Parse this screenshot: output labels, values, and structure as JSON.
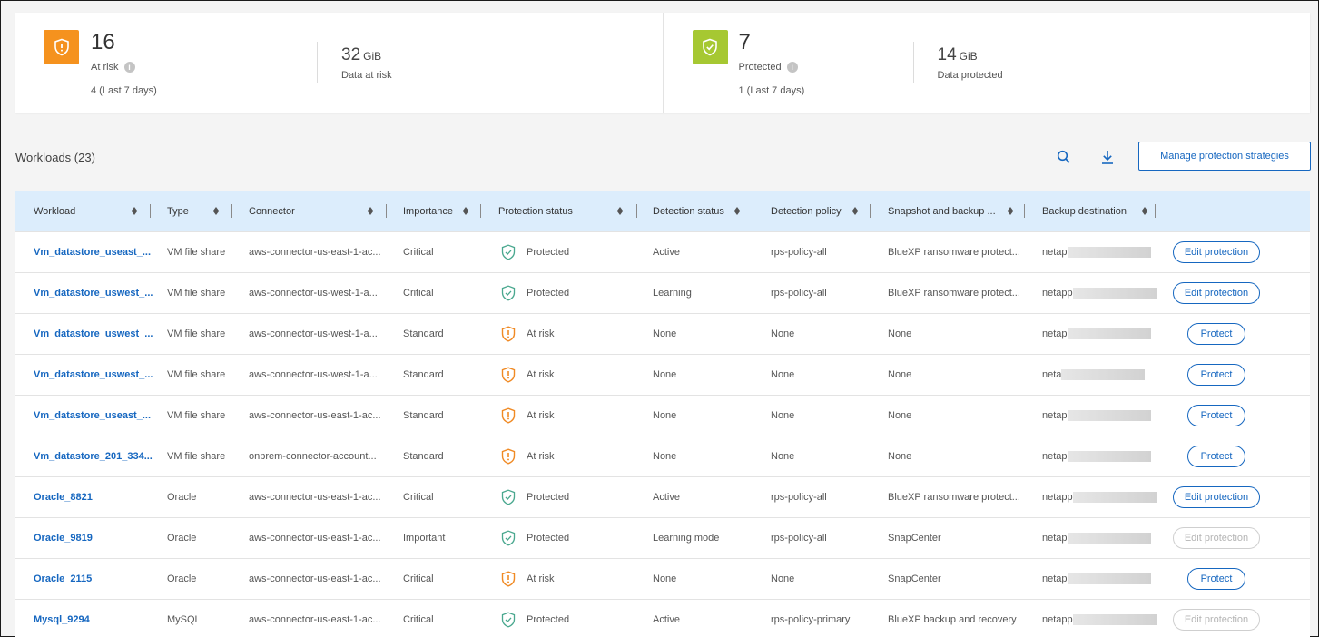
{
  "summary": {
    "at_risk": {
      "icon": "shield-exclamation-icon",
      "color": "#f5921e",
      "count": "16",
      "label": "At risk",
      "info_icon": "info-icon",
      "last7": "4 (Last 7 days)",
      "data_value": "32",
      "data_unit": "GiB",
      "data_label": "Data at risk"
    },
    "protected": {
      "icon": "shield-check-icon",
      "color": "#a6c832",
      "count": "7",
      "label": "Protected",
      "info_icon": "info-icon",
      "last7": "1 (Last 7 days)",
      "data_value": "14",
      "data_unit": "GiB",
      "data_label": "Data protected"
    }
  },
  "toolbar": {
    "title": "Workloads (23)",
    "search_icon": "search-icon",
    "download_icon": "download-icon",
    "manage_label": "Manage protection strategies"
  },
  "colors": {
    "accent": "#1667c0",
    "header_bg": "#dcedfc",
    "at_risk": "#f08a24",
    "protected": "#4aa88f"
  },
  "table": {
    "columns": [
      "Workload",
      "Type",
      "Connector",
      "Importance",
      "Protection status",
      "Detection status",
      "Detection policy",
      "Snapshot and backup ...",
      "Backup destination"
    ],
    "rows": [
      {
        "workload": "Vm_datastore_useast_...",
        "type": "VM file share",
        "connector": "aws-connector-us-east-1-ac...",
        "importance": "Critical",
        "status": "Protected",
        "detection": "Active",
        "policy": "rps-policy-all",
        "snapshot": "BlueXP ransomware protect...",
        "dest": "netap",
        "action": "Edit protection",
        "action_kind": "edit",
        "action_enabled": true
      },
      {
        "workload": "Vm_datastore_uswest_...",
        "type": "VM file share",
        "connector": "aws-connector-us-west-1-a...",
        "importance": "Critical",
        "status": "Protected",
        "detection": "Learning",
        "policy": "rps-policy-all",
        "snapshot": "BlueXP ransomware protect...",
        "dest": "netapp",
        "action": "Edit protection",
        "action_kind": "edit",
        "action_enabled": true
      },
      {
        "workload": "Vm_datastore_uswest_...",
        "type": "VM file share",
        "connector": "aws-connector-us-west-1-a...",
        "importance": "Standard",
        "status": "At risk",
        "detection": "None",
        "policy": "None",
        "snapshot": "None",
        "dest": "netap",
        "action": "Protect",
        "action_kind": "protect",
        "action_enabled": true
      },
      {
        "workload": "Vm_datastore_uswest_...",
        "type": "VM file share",
        "connector": "aws-connector-us-west-1-a...",
        "importance": "Standard",
        "status": "At risk",
        "detection": "None",
        "policy": "None",
        "snapshot": "None",
        "dest": "neta",
        "action": "Protect",
        "action_kind": "protect",
        "action_enabled": true
      },
      {
        "workload": "Vm_datastore_useast_...",
        "type": "VM file share",
        "connector": "aws-connector-us-east-1-ac...",
        "importance": "Standard",
        "status": "At risk",
        "detection": "None",
        "policy": "None",
        "snapshot": "None",
        "dest": "netap",
        "action": "Protect",
        "action_kind": "protect",
        "action_enabled": true
      },
      {
        "workload": "Vm_datastore_201_334...",
        "type": "VM file share",
        "connector": "onprem-connector-account...",
        "importance": "Standard",
        "status": "At risk",
        "detection": "None",
        "policy": "None",
        "snapshot": "None",
        "dest": "netap",
        "action": "Protect",
        "action_kind": "protect",
        "action_enabled": true
      },
      {
        "workload": "Oracle_8821",
        "type": "Oracle",
        "connector": "aws-connector-us-east-1-ac...",
        "importance": "Critical",
        "status": "Protected",
        "detection": "Active",
        "policy": "rps-policy-all",
        "snapshot": "BlueXP ransomware protect...",
        "dest": "netapp",
        "action": "Edit protection",
        "action_kind": "edit",
        "action_enabled": true
      },
      {
        "workload": "Oracle_9819",
        "type": "Oracle",
        "connector": "aws-connector-us-east-1-ac...",
        "importance": "Important",
        "status": "Protected",
        "detection": "Learning mode",
        "policy": "rps-policy-all",
        "snapshot": "SnapCenter",
        "dest": "netap",
        "action": "Edit protection",
        "action_kind": "edit",
        "action_enabled": false
      },
      {
        "workload": "Oracle_2115",
        "type": "Oracle",
        "connector": "aws-connector-us-east-1-ac...",
        "importance": "Critical",
        "status": "At risk",
        "detection": "None",
        "policy": "None",
        "snapshot": "SnapCenter",
        "dest": "netap",
        "action": "Protect",
        "action_kind": "protect",
        "action_enabled": true
      },
      {
        "workload": "Mysql_9294",
        "type": "MySQL",
        "connector": "aws-connector-us-east-1-ac...",
        "importance": "Critical",
        "status": "Protected",
        "detection": "Active",
        "policy": "rps-policy-primary",
        "snapshot": "BlueXP backup and recovery",
        "dest": "netapp",
        "action": "Edit protection",
        "action_kind": "edit",
        "action_enabled": false
      }
    ]
  }
}
